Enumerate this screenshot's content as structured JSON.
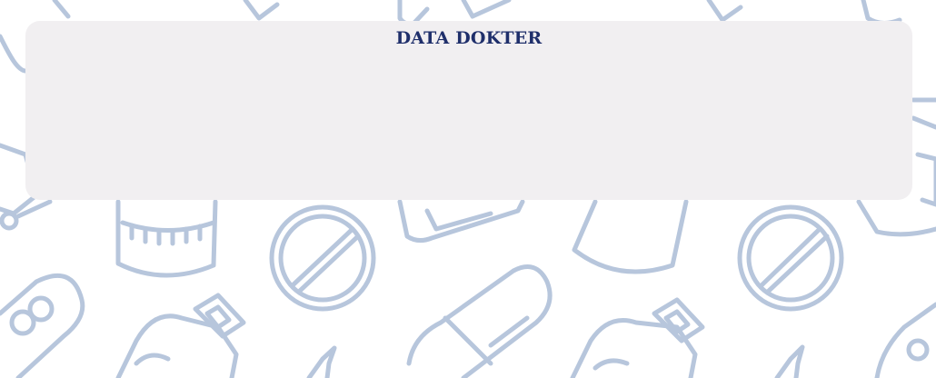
{
  "card": {
    "title": "DATA DOKTER"
  },
  "background": {
    "pattern": "medicine-outline-pattern",
    "stroke_color": "#b7c6dc",
    "page_color": "#ffffff"
  },
  "colors": {
    "card_background": "#f1eff1",
    "title_color": "#1f2f6b"
  }
}
